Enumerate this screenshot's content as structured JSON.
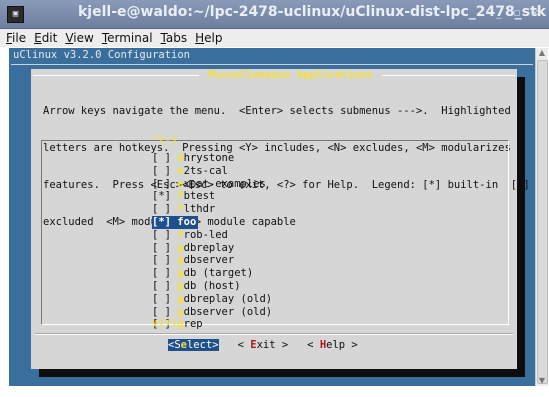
{
  "window": {
    "title": "kjell-e@waldo:~/lpc-2478-uclinux/uClinux-dist-lpc_2478_stk",
    "icon_name": "terminal-icon",
    "controls": [
      "_",
      "▫",
      "×"
    ]
  },
  "menubar": {
    "items": [
      {
        "pre": "",
        "u": "F",
        "post": "ile"
      },
      {
        "pre": "",
        "u": "E",
        "post": "dit"
      },
      {
        "pre": "",
        "u": "V",
        "post": "iew"
      },
      {
        "pre": "",
        "u": "T",
        "post": "erminal"
      },
      {
        "pre": "",
        "u": "T",
        "post": "abs"
      },
      {
        "pre": "",
        "u": "H",
        "post": "elp"
      }
    ]
  },
  "terminal": {
    "header": "uClinux v3.2.0 Configuration",
    "dialog": {
      "title": " Miscellaneous Applications ",
      "help_lines": [
        "Arrow keys navigate the menu.  <Enter> selects submenus --->.  Highlighted",
        "letters are hotkeys.  Pressing <Y> includes, <N> excludes, <M> modularizes",
        "features.  Press <Esc><Esc> to exit, <?> for Help.  Legend: [*] built-in  [ ]",
        "excluded  <M> module  < > module capable"
      ],
      "scroll_up": "^(-)",
      "scroll_down": "v(+)",
      "items": [
        {
          "mark": "[ ]",
          "hot": "d",
          "rest": "hrystone",
          "selected": false
        },
        {
          "mark": "[ ]",
          "hot": "e",
          "rest": "2ts-cal",
          "selected": false
        },
        {
          "mark": "[ ]",
          "hot": "e",
          "rest": "xpat-examples",
          "selected": false
        },
        {
          "mark": "[*]",
          "hot": "f",
          "rest": "btest",
          "selected": false
        },
        {
          "mark": "[ ]",
          "hot": "f",
          "rest": "lthdr",
          "selected": false
        },
        {
          "mark": "[*]",
          "hot": "f",
          "rest": "oo",
          "selected": true
        },
        {
          "mark": "[ ]",
          "hot": "f",
          "rest": "rob-led",
          "selected": false
        },
        {
          "mark": "[ ]",
          "hot": "g",
          "rest": "dbreplay",
          "selected": false
        },
        {
          "mark": "[ ]",
          "hot": "g",
          "rest": "dbserver",
          "selected": false
        },
        {
          "mark": "[ ]",
          "hot": "g",
          "rest": "db (target)",
          "selected": false
        },
        {
          "mark": "[ ]",
          "hot": "g",
          "rest": "db (host)",
          "selected": false
        },
        {
          "mark": "[ ]",
          "hot": "g",
          "rest": "dbreplay (old)",
          "selected": false
        },
        {
          "mark": "[ ]",
          "hot": "g",
          "rest": "dbserver (old)",
          "selected": false
        },
        {
          "mark": "[ ]",
          "hot": "g",
          "rest": "rep",
          "selected": false
        }
      ],
      "buttons": [
        {
          "open": "<",
          "pre": "S",
          "hk": "e",
          "post": "lect",
          "close": ">",
          "active": true
        },
        {
          "open": "< ",
          "pre": "",
          "hk": "E",
          "post": "xit",
          "close": " >",
          "active": false
        },
        {
          "open": "< ",
          "pre": "",
          "hk": "H",
          "post": "elp",
          "close": " >",
          "active": false
        }
      ]
    }
  },
  "colors": {
    "terminal_bg": "#3a6f9d",
    "dialog_bg": "#d6d6d6",
    "hotkey": "#f2e040",
    "selection": "#1f4f8c",
    "button_hotkey": "#b01818"
  }
}
